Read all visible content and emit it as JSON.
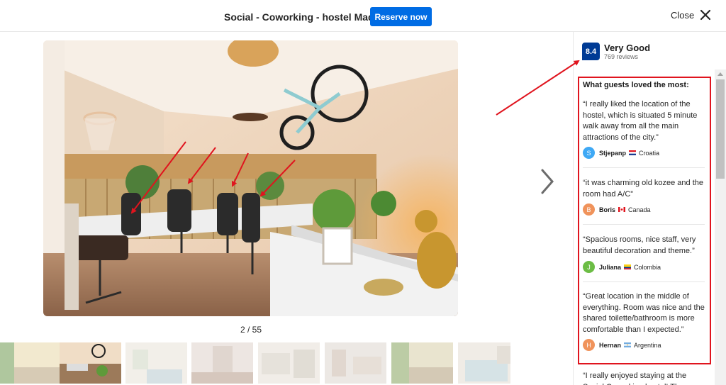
{
  "header": {
    "title": "Social - Coworking - hostel Madrid",
    "reserve_label": "Reserve now",
    "close_label": "Close"
  },
  "gallery": {
    "counter": "2 / 55",
    "current_index": 2,
    "total": 55
  },
  "rating": {
    "score": "8.4",
    "label": "Very Good",
    "reviews": "769 reviews"
  },
  "loved": {
    "title": "What guests loved the most:",
    "reviews": [
      {
        "text": "“I really liked the location of the hostel, which is situated 5 minute walk away from all the main attractions of the city.”",
        "initial": "S",
        "name": "Stjepanp",
        "country": "Croatia",
        "avatar_color": "#3fa9f5"
      },
      {
        "text": "“it was charming old kozee and the room had A/C”",
        "initial": "B",
        "name": "Boris",
        "country": "Canada",
        "avatar_color": "#f0935b"
      },
      {
        "text": "“Spacious rooms, nice staff, very beautiful decoration and theme.”",
        "initial": "J",
        "name": "Juliana",
        "country": "Colombia",
        "avatar_color": "#6cbd45"
      },
      {
        "text": "“Great location in the middle of everything. Room was nice and the shared toilette/bathroom is more comfortable than I expected.”",
        "initial": "H",
        "name": "Hernan",
        "country": "Argentina",
        "avatar_color": "#f0935b"
      }
    ],
    "next_review_text": "“I really enjoyed staying at the Social Coworking hostel! The interior"
  },
  "colors": {
    "brand_blue": "#006ce4",
    "score_blue": "#003b95",
    "annotation_red": "#e0141e"
  }
}
